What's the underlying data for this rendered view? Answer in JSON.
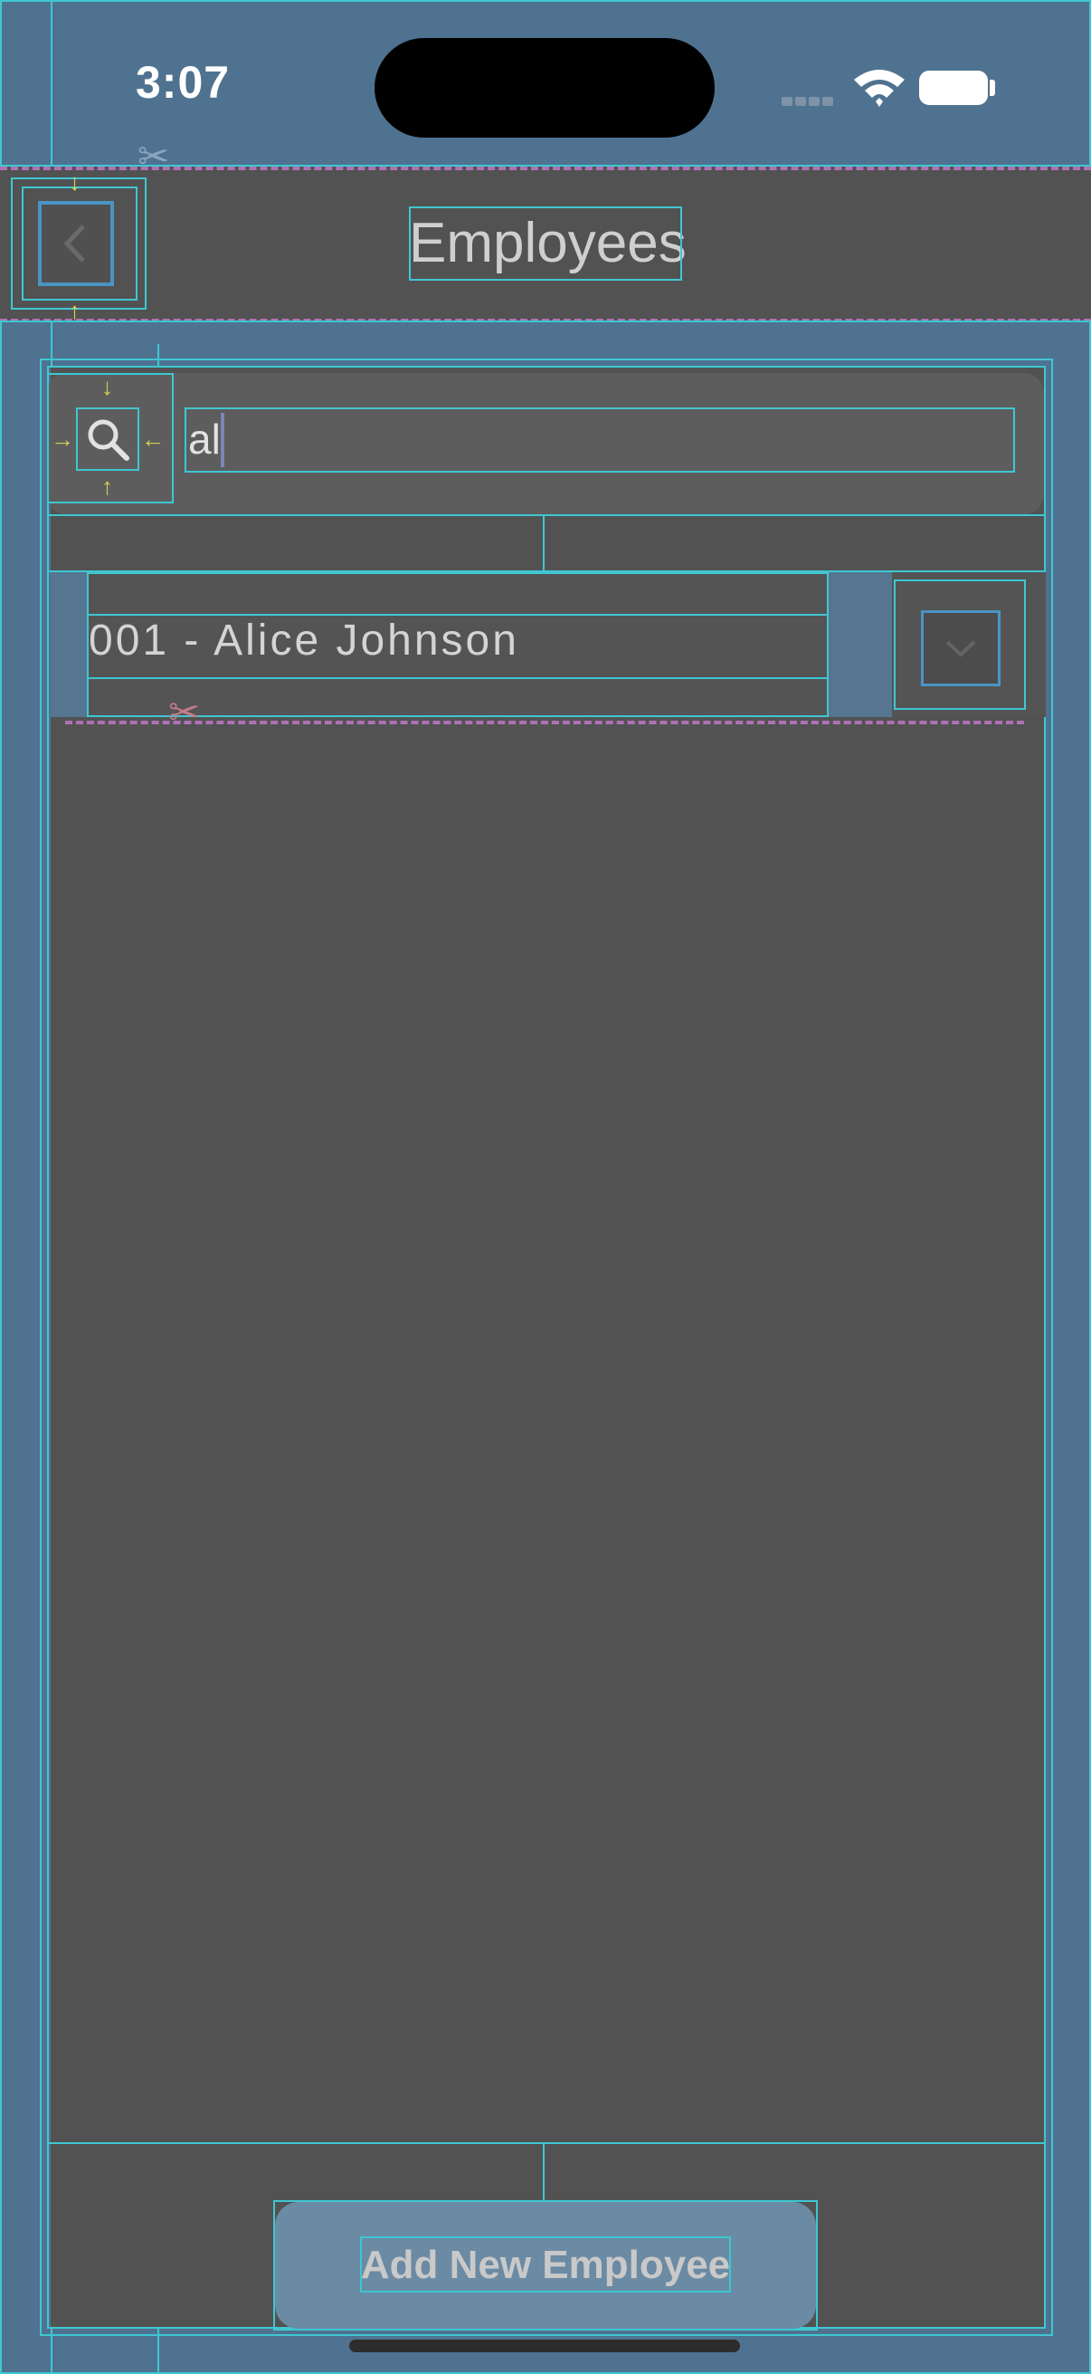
{
  "status_bar": {
    "time": "3:07"
  },
  "nav": {
    "title": "Employees",
    "back_icon": "chevron-left-icon"
  },
  "search": {
    "value": "al",
    "icon": "search-icon"
  },
  "picker": {
    "selected": "001 - Alice Johnson",
    "icon": "chevron-down-icon"
  },
  "actions": {
    "add_label": "Add New Employee"
  },
  "colors": {
    "accent": "#3ec7d2",
    "background": "#4f7290",
    "panel": "#525252"
  }
}
